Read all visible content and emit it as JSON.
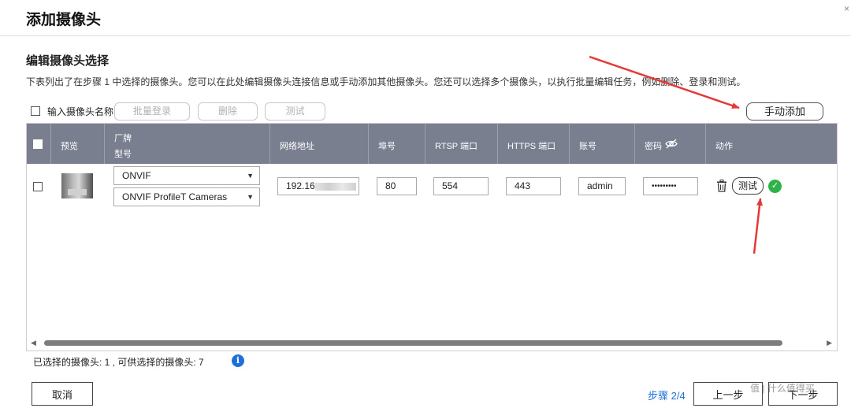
{
  "dialog": {
    "title": "添加摄像头",
    "close": "×"
  },
  "section": {
    "title": "编辑摄像头选择",
    "description": "下表列出了在步骤 1 中选择的摄像头。您可以在此处编辑摄像头连接信息或手动添加其他摄像头。您还可以选择多个摄像头，以执行批量编辑任务，例如删除、登录和测试。"
  },
  "toolbar": {
    "name_label": "输入摄像头名称",
    "batch_login": "批量登录",
    "delete": "删除",
    "test": "测试",
    "manual_add": "手动添加"
  },
  "table": {
    "headers": {
      "preview": "预览",
      "brand": "厂牌",
      "model": "型号",
      "address": "网络地址",
      "port": "埠号",
      "rtsp": "RTSP 端口",
      "https": "HTTPS 端口",
      "account": "账号",
      "password": "密码",
      "action": "动作"
    },
    "row": {
      "brand": "ONVIF",
      "model": "ONVIF ProfileT Cameras",
      "address": "192.16",
      "port": "80",
      "rtsp": "554",
      "https": "443",
      "account": "admin",
      "password": "•••••••••",
      "test": "测试"
    }
  },
  "summary": {
    "text": "已选择的摄像头:  1  , 可供选择的摄像头:  7",
    "info": "i"
  },
  "footer": {
    "cancel": "取消",
    "step": "步骤 2/4",
    "prev": "上一步",
    "next": "下一步"
  },
  "watermark": "值 | 什么值得买",
  "colors": {
    "header_bg": "#7a7f8f",
    "accent_blue": "#1e6fd9",
    "success_green": "#2eb24a",
    "annotation_red": "#e53935"
  }
}
